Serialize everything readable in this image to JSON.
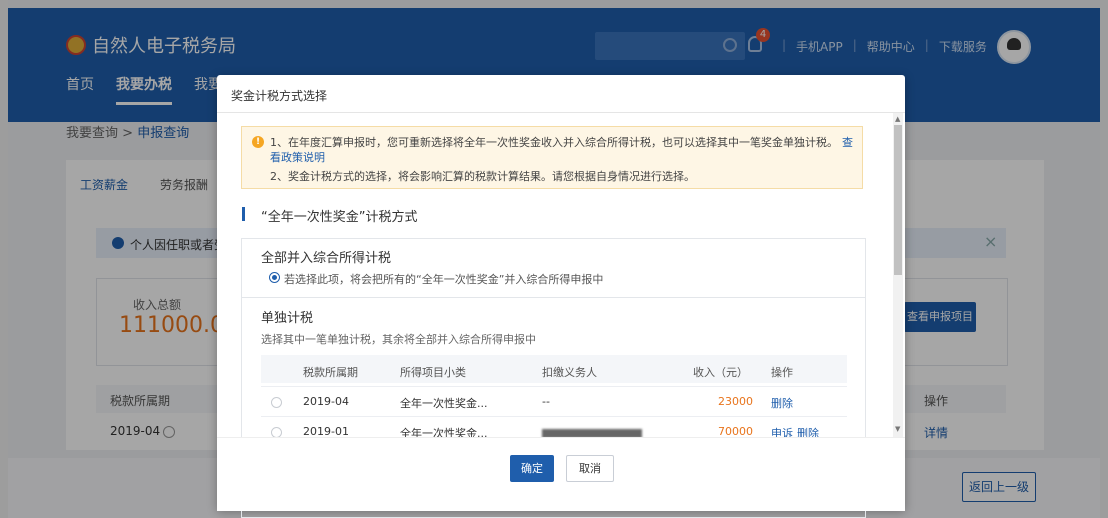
{
  "header": {
    "site_name": "自然人电子税务局",
    "badge_count": "4",
    "links": [
      "手机APP",
      "帮助中心",
      "下载服务"
    ],
    "nav": [
      "首页",
      "我要办税",
      "我要"
    ]
  },
  "breadcrumb": {
    "items": [
      "我要查询",
      "申报查询"
    ],
    "separator": ">"
  },
  "tabs": [
    "工资薪金",
    "劳务报酬"
  ],
  "info_bar": "个人因任职或者受",
  "income": {
    "label": "收入总额",
    "value": "111000.0"
  },
  "bg_button": "查看申报项目",
  "bg_table": {
    "header_left": "税款所属期",
    "header_right": "操作",
    "row_period": "2019-04",
    "row_action": "详情"
  },
  "back_button": "返回上一级",
  "modal": {
    "title": "奖金计税方式选择",
    "notice": {
      "line1": "1、在年度汇算申报时，您可重新选择将全年一次性奖金收入并入综合所得计税，也可以选择其中一笔奖金单独计税。",
      "link": "查看政策说明",
      "line2": "2、奖金计税方式的选择，将会影响汇算的税款计算结果。请您根据自身情况进行选择。"
    },
    "section_title": "“全年一次性奖金”计税方式",
    "option1": {
      "title": "全部并入综合所得计税",
      "desc": "若选择此项，将会把所有的“全年一次性奖金”并入综合所得申报中"
    },
    "option2": {
      "title": "单独计税",
      "desc": "选择其中一笔单独计税，其余将全部并入综合所得申报中",
      "columns": [
        "税款所属期",
        "所得项目小类",
        "扣缴义务人",
        "收入（元）",
        "操作"
      ],
      "rows": [
        {
          "period": "2019-04",
          "category": "全年一次性奖金...",
          "withholder": "--",
          "income": "23000",
          "action1": "删除",
          "action2": ""
        },
        {
          "period": "2019-01",
          "category": "全年一次性奖金...",
          "withholder": "",
          "income": "70000",
          "action1": "申诉",
          "action2": "删除"
        }
      ]
    },
    "ok_label": "确定",
    "cancel_label": "取消"
  },
  "colors": {
    "primary": "#1f5eac",
    "amount": "#e8741c",
    "warning": "#f5a623"
  }
}
